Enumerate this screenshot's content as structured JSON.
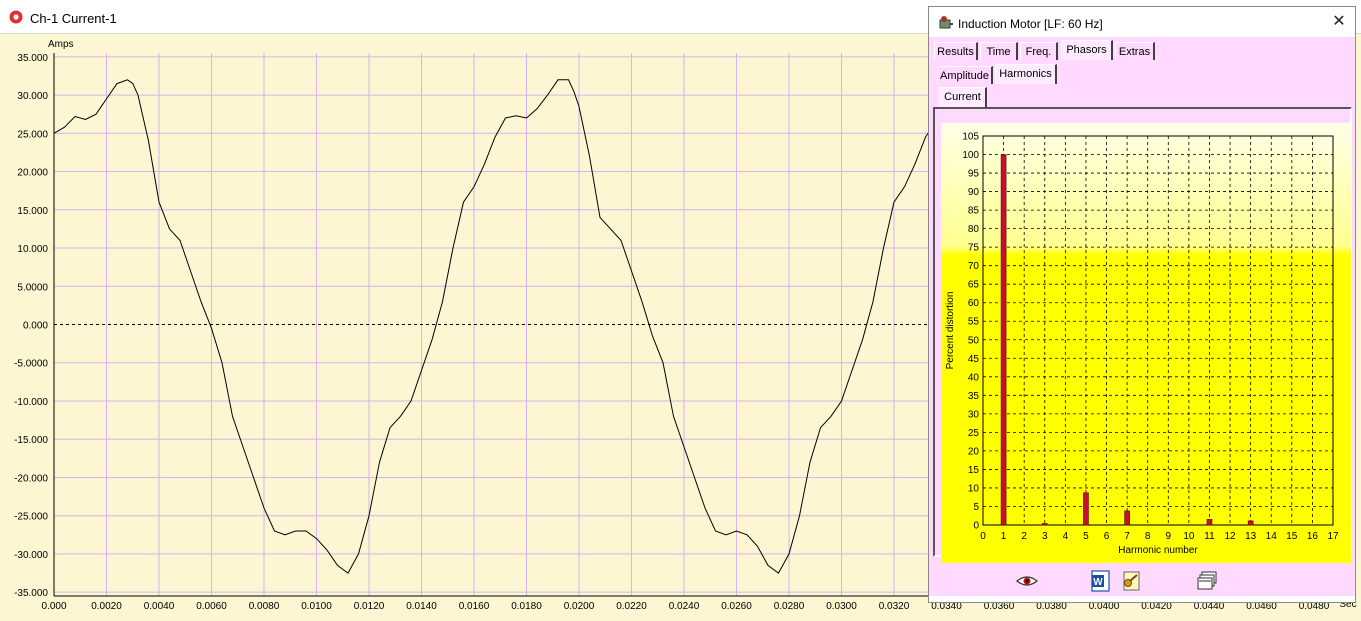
{
  "window": {
    "title": "Ch-1 Current-1",
    "icon": "red-circle-app-icon"
  },
  "chart_data": {
    "type": "line",
    "ylabel": "Amps",
    "xlabel": "Sec",
    "yticks": [
      "35.000",
      "30.000",
      "25.000",
      "20.000",
      "15.000",
      "10.000",
      "5.0000",
      "0.000",
      "-5.0000",
      "-10.000",
      "-15.000",
      "-20.000",
      "-25.000",
      "-30.000",
      "-35.000"
    ],
    "ytick_values": [
      35,
      30,
      25,
      20,
      15,
      10,
      5,
      0,
      -5,
      -10,
      -15,
      -20,
      -25,
      -30,
      -35
    ],
    "xticks": [
      "0.000",
      "0.0020",
      "0.0040",
      "0.0060",
      "0.0080",
      "0.0100",
      "0.0120",
      "0.0140",
      "0.0160",
      "0.0180",
      "0.0200",
      "0.0220",
      "0.0240",
      "0.0260",
      "0.0280",
      "0.0300",
      "0.0320",
      "0.0340",
      "0.0360",
      "0.0380",
      "0.0400",
      "0.0420",
      "0.0440",
      "0.0460",
      "0.0480"
    ],
    "xtick_values": [
      0,
      0.002,
      0.004,
      0.006,
      0.008,
      0.01,
      0.012,
      0.014,
      0.016,
      0.018,
      0.02,
      0.022,
      0.024,
      0.026,
      0.028,
      0.03,
      0.032,
      0.034,
      0.036,
      0.038,
      0.04,
      0.042,
      0.044,
      0.046,
      0.048
    ],
    "xlim": [
      0,
      0.0496
    ],
    "ylim": [
      -35.5,
      35.5
    ],
    "grid": true,
    "zero_line": "dashed",
    "colors": {
      "background": "#fdf6d3",
      "grid": "#d9b2ee",
      "line": "#000000"
    },
    "series": [
      {
        "x": [
          0,
          0.0004,
          0.0008,
          0.0012,
          0.0016,
          0.002,
          0.0024,
          0.0028,
          0.003,
          0.0032,
          0.0036,
          0.004,
          0.0044,
          0.0048,
          0.0052,
          0.0056,
          0.006,
          0.0064,
          0.0068,
          0.0072,
          0.0076,
          0.008,
          0.0084,
          0.0088,
          0.0092,
          0.0096,
          0.01,
          0.0104,
          0.0108,
          0.0112,
          0.0116,
          0.012,
          0.0124,
          0.0128,
          0.0132,
          0.0136,
          0.014,
          0.0144,
          0.0148,
          0.0152,
          0.0156,
          0.016,
          0.0164,
          0.0168,
          0.0172,
          0.0176,
          0.018,
          0.0184,
          0.0188,
          0.0192,
          0.0196,
          0.0198,
          0.02,
          0.0204,
          0.0208,
          0.0212,
          0.0216,
          0.022,
          0.0224,
          0.0228,
          0.0232,
          0.0236,
          0.024,
          0.0244,
          0.0248,
          0.0252,
          0.0256,
          0.026,
          0.0264,
          0.0268,
          0.0272,
          0.0276,
          0.028,
          0.0284,
          0.0288,
          0.0292,
          0.0296,
          0.03,
          0.0304,
          0.0308,
          0.0312,
          0.0316,
          0.032,
          0.0324,
          0.0328,
          0.0332,
          0.0336,
          0.034
        ],
        "y": [
          25,
          25.8,
          27.2,
          26.8,
          27.5,
          29.5,
          31.5,
          32,
          31.5,
          30,
          24,
          16,
          12.5,
          11,
          7,
          3,
          -0.5,
          -5,
          -12,
          -16,
          -20,
          -24,
          -27,
          -27.5,
          -27,
          -27,
          -28,
          -29.5,
          -31.5,
          -32.5,
          -30,
          -25,
          -18,
          -13.5,
          -12,
          -10,
          -6,
          -2,
          3,
          10,
          16,
          18,
          21,
          24.5,
          27,
          27.3,
          27,
          28.2,
          30,
          32,
          32,
          30.5,
          28.5,
          22,
          14,
          12.5,
          11,
          7,
          3,
          -1.5,
          -5,
          -12,
          -16,
          -20,
          -24,
          -27,
          -27.5,
          -27,
          -27.5,
          -29,
          -31.5,
          -32.5,
          -30,
          -25,
          -18,
          -13.5,
          -12,
          -10,
          -6,
          -2,
          3,
          10,
          16,
          18,
          21,
          24.5,
          26.5,
          27
        ]
      }
    ]
  },
  "panel": {
    "title": "Induction Motor  [LF: 60 Hz]",
    "icon": "motor-icon",
    "close_label": "✕",
    "tabs": [
      "Results",
      "Time",
      "Freq.",
      "Phasors",
      "Extras"
    ],
    "active_tab": "Phasors",
    "subtabs": [
      "Amplitude",
      "Harmonics"
    ],
    "active_subtab": "Harmonics",
    "subsubtabs": [
      "Current"
    ],
    "toolbar_icons": [
      "eye-icon",
      "word-export-icon",
      "key-tools-icon",
      "windows-icon"
    ]
  },
  "harmonics_chart": {
    "type": "bar",
    "ylabel": "Percent distortion",
    "xlabel": "Harmonic number",
    "categories": [
      0,
      1,
      2,
      3,
      4,
      5,
      6,
      7,
      8,
      9,
      10,
      11,
      12,
      13,
      14,
      15,
      16,
      17
    ],
    "xtick_labels": [
      "0",
      "1",
      "2",
      "3",
      "4",
      "5",
      "6",
      "7",
      "8",
      "9",
      "10",
      "11",
      "12",
      "13",
      "14",
      "15",
      "16",
      "17"
    ],
    "ytick_labels": [
      "105",
      "100",
      "95",
      "90",
      "85",
      "80",
      "75",
      "70",
      "65",
      "60",
      "55",
      "50",
      "45",
      "40",
      "35",
      "30",
      "25",
      "20",
      "15",
      "10",
      "5",
      "0"
    ],
    "ylim": [
      0,
      105
    ],
    "harmonics": [
      1,
      3,
      5,
      7,
      11,
      13
    ],
    "values": [
      100,
      0.4,
      8.7,
      3.8,
      1.5,
      1.1
    ],
    "grid": "dashed",
    "colors": {
      "bar": "#c8102e",
      "plot_top": "#ffffe8",
      "plot_bottom": "#ffff00"
    }
  }
}
